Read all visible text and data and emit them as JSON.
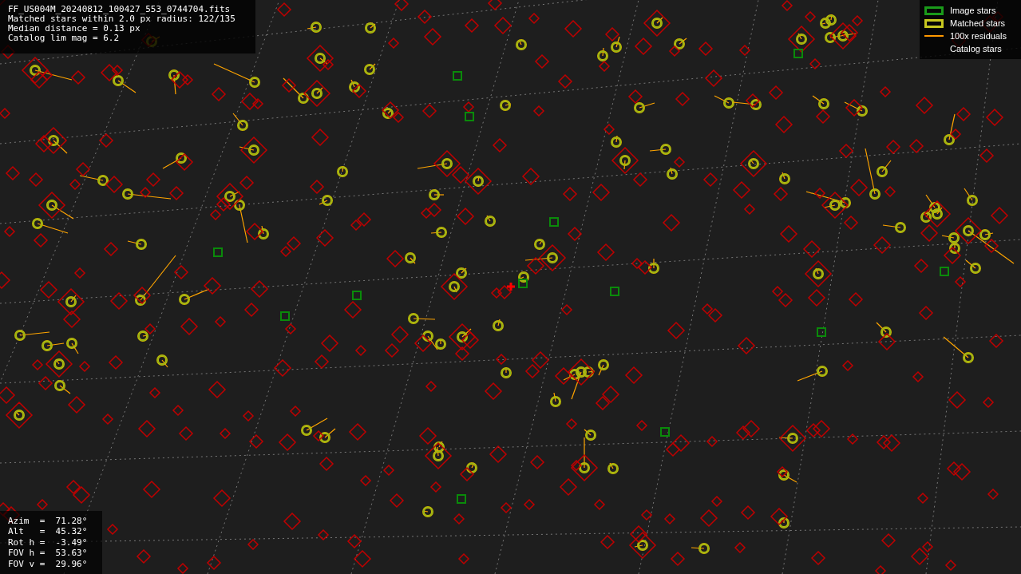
{
  "file_info": [
    "FF_US004M_20240812_100427_553_0744704.fits",
    "Matched stars within 2.0 px radius: 122/135",
    "Median distance = 0.13 px",
    "Catalog lim mag = 6.2"
  ],
  "legend": [
    {
      "kind": "image",
      "label": "Image stars"
    },
    {
      "kind": "matched",
      "label": "Matched stars"
    },
    {
      "kind": "residual",
      "label": "100x residuals"
    },
    {
      "kind": "catalog",
      "label": "Catalog stars"
    }
  ],
  "pointing": [
    "Azim  =  71.28°",
    "Alt   =  45.32°",
    "Rot h =  -3.49°",
    "FOV h =  53.63°",
    "FOV v =  29.96°"
  ]
}
